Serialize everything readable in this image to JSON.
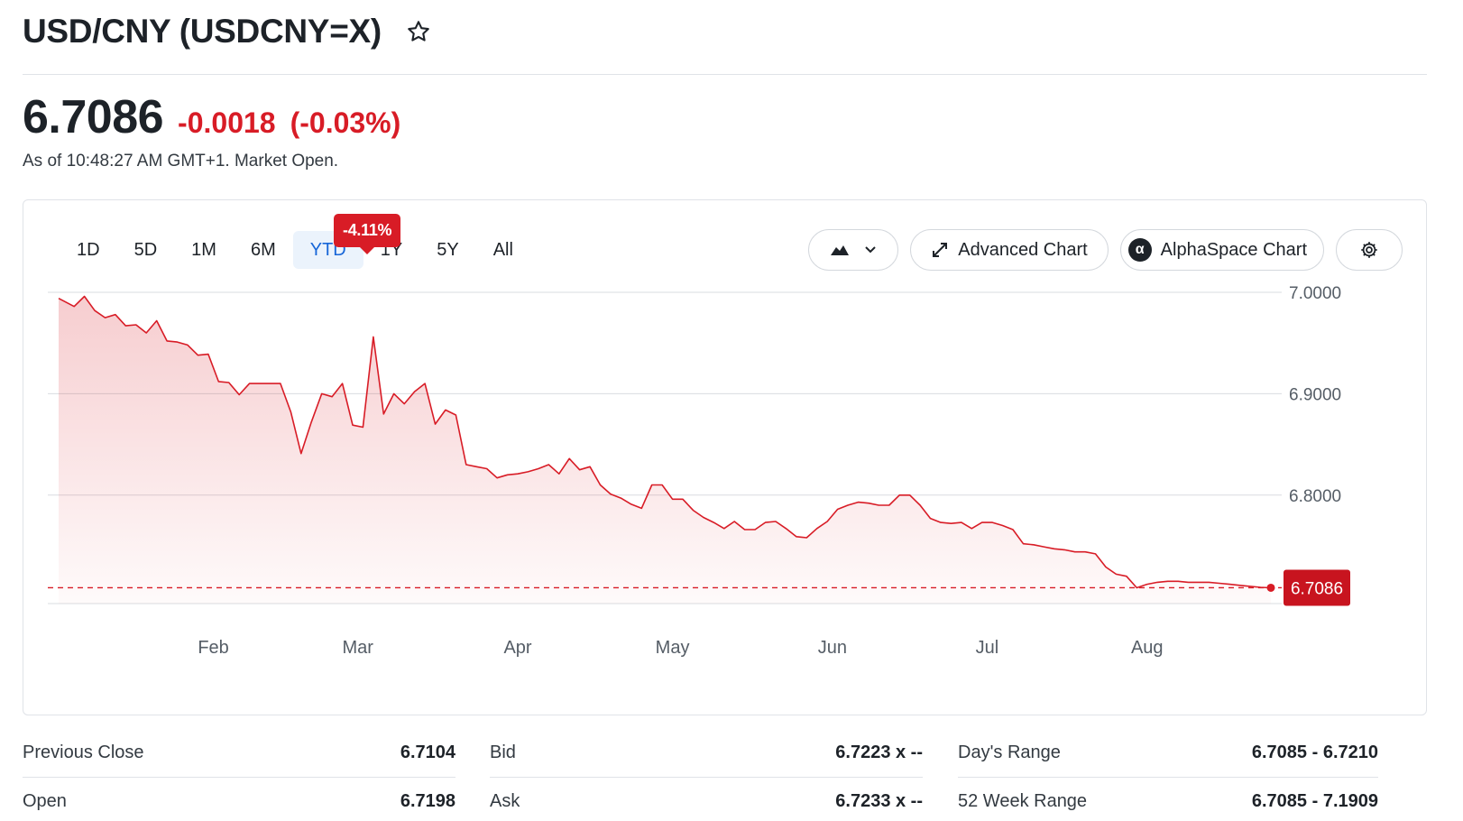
{
  "header": {
    "title": "USD/CNY (USDCNY=X)",
    "star_icon": "star-outline-icon"
  },
  "quote": {
    "price": "6.7086",
    "change": "-0.0018",
    "change_pct": "(-0.03%)",
    "as_of": "As of 10:48:27 AM GMT+1. Market Open.",
    "negative_color": "#d81c26"
  },
  "chart_controls": {
    "ranges": [
      "1D",
      "5D",
      "1M",
      "6M",
      "YTD",
      "1Y",
      "5Y",
      "All"
    ],
    "active_range": "YTD",
    "ytd_badge": "-4.11%",
    "chart_type_icon": "mountain-chart-icon",
    "advanced_chart_label": "Advanced Chart",
    "alphaspace_label": "AlphaSpace Chart",
    "alphaspace_glyph": "α",
    "settings_icon": "gear-icon"
  },
  "chart_data": {
    "type": "area",
    "title": "",
    "xlabel": "",
    "ylabel": "",
    "x_tick_labels": [
      "Feb",
      "Mar",
      "Apr",
      "May",
      "Jun",
      "Jul",
      "Aug"
    ],
    "y_tick_labels": [
      "7.0000",
      "6.9000",
      "6.8000"
    ],
    "y_ticks": [
      7.0,
      6.9,
      6.8
    ],
    "ylim": [
      6.693,
      7.0
    ],
    "grid": true,
    "series_color": "#d81c26",
    "current_value": 6.7086,
    "current_label": "6.7086",
    "series": [
      {
        "name": "",
        "x": [
          "2023-01-02",
          "2023-01-05",
          "2023-01-07",
          "2023-01-09",
          "2023-01-11",
          "2023-01-13",
          "2023-01-15",
          "2023-01-17",
          "2023-01-19",
          "2023-01-21",
          "2023-01-23",
          "2023-01-25",
          "2023-01-27",
          "2023-01-29",
          "2023-01-31",
          "2023-02-02",
          "2023-02-04",
          "2023-02-06",
          "2023-02-08",
          "2023-02-10",
          "2023-02-12",
          "2023-02-14",
          "2023-02-16",
          "2023-02-18",
          "2023-02-20",
          "2023-02-22",
          "2023-02-24",
          "2023-02-26",
          "2023-02-28",
          "2023-03-02",
          "2023-03-04",
          "2023-03-06",
          "2023-03-08",
          "2023-03-10",
          "2023-03-12",
          "2023-03-14",
          "2023-03-16",
          "2023-03-18",
          "2023-03-20",
          "2023-03-22",
          "2023-03-24",
          "2023-03-26",
          "2023-03-28",
          "2023-03-30",
          "2023-04-01",
          "2023-04-03",
          "2023-04-05",
          "2023-04-07",
          "2023-04-09",
          "2023-04-11",
          "2023-04-13",
          "2023-04-15",
          "2023-04-17",
          "2023-04-19",
          "2023-04-21",
          "2023-04-23",
          "2023-04-25",
          "2023-04-27",
          "2023-04-29",
          "2023-05-01",
          "2023-05-03",
          "2023-05-05",
          "2023-05-07",
          "2023-05-09",
          "2023-05-11",
          "2023-05-13",
          "2023-05-15",
          "2023-05-17",
          "2023-05-19",
          "2023-05-21",
          "2023-05-23",
          "2023-05-25",
          "2023-05-27",
          "2023-05-29",
          "2023-05-31",
          "2023-06-02",
          "2023-06-04",
          "2023-06-06",
          "2023-06-08",
          "2023-06-10",
          "2023-06-12",
          "2023-06-14",
          "2023-06-16",
          "2023-06-18",
          "2023-06-20",
          "2023-06-22",
          "2023-06-24",
          "2023-06-26",
          "2023-06-28",
          "2023-06-30",
          "2023-07-02",
          "2023-07-04",
          "2023-07-06",
          "2023-07-08",
          "2023-07-10",
          "2023-07-12",
          "2023-07-14",
          "2023-07-16",
          "2023-07-18",
          "2023-07-20",
          "2023-07-22",
          "2023-07-24",
          "2023-07-26",
          "2023-07-28",
          "2023-07-30",
          "2023-08-01",
          "2023-08-03",
          "2023-08-05",
          "2023-08-07",
          "2023-08-09",
          "2023-08-11",
          "2023-08-13",
          "2023-08-15",
          "2023-08-17",
          "2023-08-19",
          "2023-08-21",
          "2023-08-23",
          "2023-08-25"
        ],
        "values": [
          6.994,
          6.986,
          6.996,
          6.982,
          6.975,
          6.978,
          6.967,
          6.968,
          6.96,
          6.972,
          6.952,
          6.951,
          6.948,
          6.938,
          6.939,
          6.912,
          6.911,
          6.899,
          6.91,
          6.91,
          6.91,
          6.91,
          6.882,
          6.841,
          6.872,
          6.9,
          6.897,
          6.91,
          6.869,
          6.867,
          6.956,
          6.88,
          6.9,
          6.89,
          6.902,
          6.91,
          6.87,
          6.884,
          6.879,
          6.83,
          6.828,
          6.826,
          6.817,
          6.82,
          6.821,
          6.823,
          6.826,
          6.83,
          6.821,
          6.836,
          6.825,
          6.828,
          6.81,
          6.801,
          6.797,
          6.791,
          6.787,
          6.81,
          6.81,
          6.796,
          6.796,
          6.785,
          6.778,
          6.773,
          6.767,
          6.774,
          6.766,
          6.766,
          6.773,
          6.774,
          6.767,
          6.759,
          6.758,
          6.767,
          6.774,
          6.786,
          6.79,
          6.793,
          6.792,
          6.79,
          6.79,
          6.8,
          6.8,
          6.79,
          6.777,
          6.773,
          6.772,
          6.773,
          6.767,
          6.773,
          6.773,
          6.77,
          6.766,
          6.752,
          6.751,
          6.749,
          6.747,
          6.746,
          6.744,
          6.744,
          6.742,
          6.729,
          6.722,
          6.72,
          6.7086,
          6.712,
          6.714,
          6.715,
          6.715,
          6.714,
          6.714,
          6.714,
          6.713,
          6.712,
          6.711,
          6.71,
          6.709,
          6.7086
        ]
      }
    ]
  },
  "stats": {
    "col1": [
      {
        "label": "Previous Close",
        "value": "6.7104"
      },
      {
        "label": "Open",
        "value": "6.7198"
      }
    ],
    "col2": [
      {
        "label": "Bid",
        "value": "6.7223 x --"
      },
      {
        "label": "Ask",
        "value": "6.7233 x --"
      }
    ],
    "col3": [
      {
        "label": "Day's Range",
        "value": "6.7085 - 6.7210"
      },
      {
        "label": "52 Week Range",
        "value": "6.7085 - 7.1909"
      }
    ]
  }
}
